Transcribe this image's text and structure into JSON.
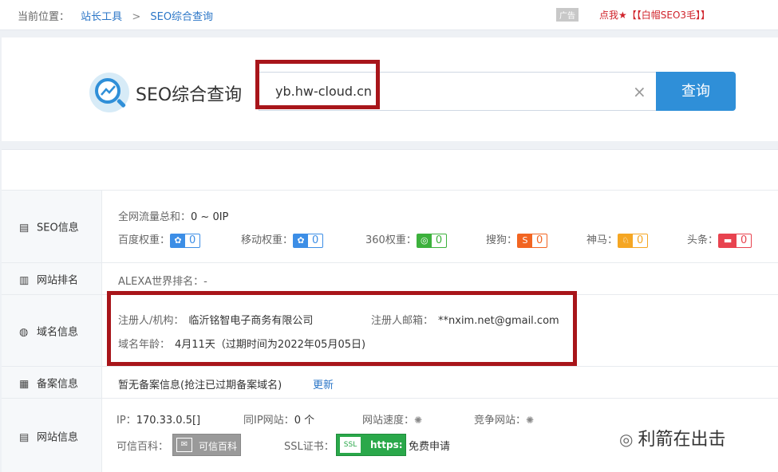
{
  "breadcrumb": {
    "prefix": "当前位置：",
    "items": [
      "站长工具",
      "SEO综合查询"
    ],
    "separator": ">"
  },
  "ad": {
    "tag": "广告",
    "promo_text": "点我★【【白帽SEO3毛】】"
  },
  "search": {
    "title": "SEO综合查询",
    "value": "yb.hw-cloud.cn",
    "clear_icon": "×",
    "button_label": "查询"
  },
  "rows": {
    "seo": {
      "label": "SEO信息",
      "traffic_label": "全网流量总和：",
      "traffic_value": "0 ~ 0IP",
      "weights": [
        {
          "label": "百度权重：",
          "icon": "baidu-paw-icon",
          "value": "0",
          "color": "#3c8ee6"
        },
        {
          "label": "移动权重：",
          "icon": "mobile-paw-icon",
          "value": "0",
          "color": "#3c8ee6"
        },
        {
          "label": "360权重：",
          "icon": "360-icon",
          "value": "0",
          "color": "#3cb13c"
        },
        {
          "label": "搜狗：",
          "icon": "sogou-icon",
          "value": "0",
          "color": "#f26522"
        },
        {
          "label": "神马：",
          "icon": "shenma-icon",
          "value": "0",
          "color": "#f5a623"
        },
        {
          "label": "头条：",
          "icon": "toutiao-icon",
          "value": "0",
          "color": "#e8434f"
        }
      ]
    },
    "rank": {
      "label": "网站排名",
      "alexa_label": "ALEXA世界排名：",
      "alexa_value": "-"
    },
    "domain": {
      "label": "域名信息",
      "registrant_label": "注册人/机构：",
      "registrant_value": "临沂铭智电子商务有限公司",
      "email_label": "注册人邮箱：",
      "email_value": "**nxim.net@gmail.com",
      "age_label": "域名年龄：",
      "age_value": "4月11天（过期时间为2022年05月05日)"
    },
    "icp": {
      "label": "备案信息",
      "text": "暂无备案信息(抢注已过期备案域名)",
      "update_link": "更新"
    },
    "site": {
      "label": "网站信息",
      "ip_label": "IP：",
      "ip_value": "170.33.0.5[]",
      "same_ip_label": "同IP网站：",
      "same_ip_value": "0 个",
      "speed_label": "网站速度：",
      "compete_label": "竞争网站：",
      "trust_label": "可信百科：",
      "trust_badge": "可信百科",
      "ssl_label": "SSL证书：",
      "ssl_badge_text": "https:",
      "ssl_link": "免费申请"
    }
  },
  "watermark": "利箭在出击",
  "colors": {
    "highlight": "#a8151a",
    "accent": "#2f8fd8",
    "link": "#2b76c7",
    "promo": "#d0232b"
  }
}
